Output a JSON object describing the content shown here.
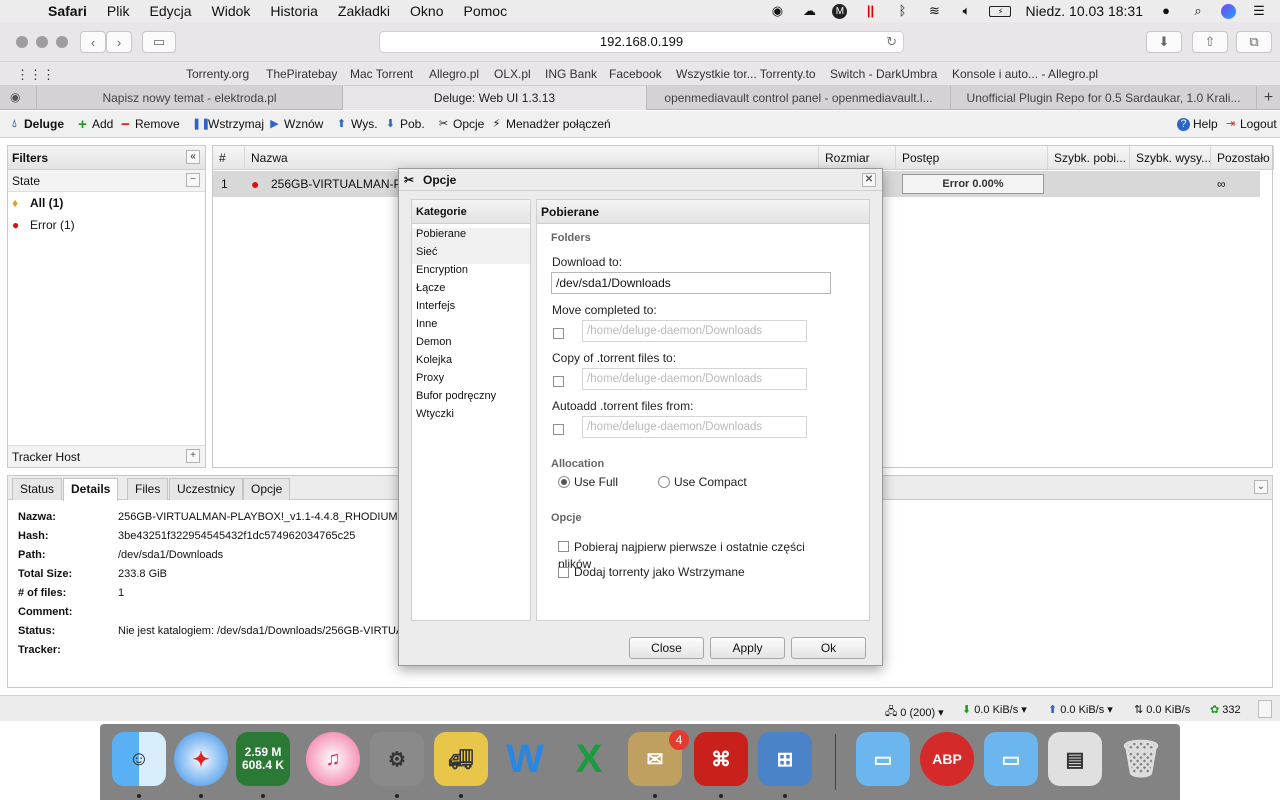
{
  "menubar": {
    "app": "Safari",
    "items": [
      "Plik",
      "Edycja",
      "Widok",
      "Historia",
      "Zakładki",
      "Okno",
      "Pomoc"
    ],
    "clock": "Niedz. 10.03  18:31"
  },
  "browser": {
    "url": "192.168.0.199",
    "favorites": [
      "Torrenty.org",
      "ThePiratebay",
      "Mac Torrent",
      "Allegro.pl",
      "OLX.pl",
      "ING Bank",
      "Facebook",
      "Wszystkie tor... Torrenty.to",
      "Switch - DarkUmbra",
      "Konsole i auto... - Allegro.pl"
    ],
    "tabs": [
      {
        "label": "Napisz nowy temat - elektroda.pl"
      },
      {
        "label": "Deluge: Web UI 1.3.13"
      },
      {
        "label": "openmediavault control panel - openmediavault.l..."
      },
      {
        "label": "Unofficial Plugin Repo for 0.5 Sardaukar, 1.0 Krali..."
      }
    ]
  },
  "deluge": {
    "toolbar": {
      "app_name": "Deluge",
      "add": "Add",
      "remove": "Remove",
      "pause": "Wstrzymaj",
      "resume": "Wznów",
      "up": "Wys.",
      "down": "Pob.",
      "options": "Opcje",
      "connection_manager": "Menadżer połączeń",
      "help": "Help",
      "logout": "Logout"
    },
    "filters": {
      "title": "Filters",
      "state_label": "State",
      "all": "All (1)",
      "error": "Error (1)",
      "tracker_host": "Tracker Host"
    },
    "table": {
      "columns": [
        "#",
        "Nazwa",
        "Rozmiar",
        "Postęp",
        "Szybk. pobi...",
        "Szybk. wysy...",
        "Pozostało"
      ],
      "row": {
        "num": "1",
        "name": "256GB-VIRTUALMAN-PLAYBOX!_v1.1-4.4.8_RHODIUM",
        "progress_text": "Error 0.00%",
        "progress": 0,
        "eta": "∞"
      }
    },
    "bottom": {
      "tabs": [
        "Status",
        "Details",
        "Files",
        "Uczestnicy",
        "Opcje"
      ],
      "active_tab": "Details",
      "details": [
        {
          "label": "Nazwa:",
          "value": "256GB-VIRTUALMAN-PLAYBOX!_v1.1-4.4.8_RHODIUM"
        },
        {
          "label": "Hash:",
          "value": "3be43251f322954545432f1dc574962034765c25"
        },
        {
          "label": "Path:",
          "value": "/dev/sda1/Downloads"
        },
        {
          "label": "Total Size:",
          "value": "233.8 GiB"
        },
        {
          "label": "# of files:",
          "value": "1"
        },
        {
          "label": "Comment:",
          "value": ""
        },
        {
          "label": "Status:",
          "value": "Nie jest katalogiem: /dev/sda1/Downloads/256GB-VIRTUA"
        },
        {
          "label": "Tracker:",
          "value": ""
        }
      ]
    },
    "status_bar": {
      "connections": "0 (200)",
      "down_speed": "0.0 KiB/s",
      "up_speed": "0.0 KiB/s",
      "protocol": "0.0 KiB/s",
      "dht": "332"
    }
  },
  "dialog": {
    "title": "Opcje",
    "categories_title": "Kategorie",
    "categories": [
      "Pobierane",
      "Sieć",
      "Encryption",
      "Łącze",
      "Interfejs",
      "Inne",
      "Demon",
      "Kolejka",
      "Proxy",
      "Bufor podręczny",
      "Wtyczki"
    ],
    "selected_category": "Pobierane",
    "panel_title": "Pobierane",
    "folders_label": "Folders",
    "download_to_label": "Download to:",
    "download_to_value": "/dev/sda1/Downloads",
    "move_completed_label": "Move completed to:",
    "move_completed_value": "/home/deluge-daemon/Downloads",
    "copy_torrent_label": "Copy of .torrent files to:",
    "copy_torrent_value": "/home/deluge-daemon/Downloads",
    "autoadd_label": "Autoadd .torrent files from:",
    "autoadd_value": "/home/deluge-daemon/Downloads",
    "allocation_label": "Allocation",
    "use_full": "Use Full",
    "use_compact": "Use Compact",
    "options_label": "Opcje",
    "first_last": "Pobieraj najpierw pierwsze i ostatnie części plików",
    "add_paused": "Dodaj torrenty jako Wstrzymane",
    "buttons": {
      "close": "Close",
      "apply": "Apply",
      "ok": "Ok"
    }
  },
  "dock": {
    "monitor_up": "2.59 M",
    "monitor_down": "608.4 K",
    "mail_badge": "4",
    "abp": "ABP"
  }
}
